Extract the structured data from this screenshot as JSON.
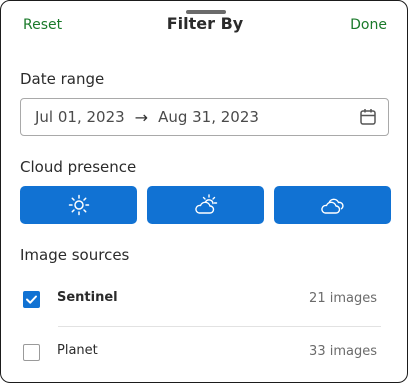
{
  "header": {
    "reset_label": "Reset",
    "title": "Filter By",
    "done_label": "Done"
  },
  "date_range": {
    "label": "Date range",
    "start": "Jul 01, 2023",
    "arrow": "→",
    "end": "Aug 31, 2023",
    "icon": "calendar-icon"
  },
  "cloud_presence": {
    "label": "Cloud presence",
    "options": [
      {
        "icon": "sun-icon",
        "selected": true
      },
      {
        "icon": "partly-cloudy-icon",
        "selected": true
      },
      {
        "icon": "cloudy-icon",
        "selected": true
      }
    ]
  },
  "image_sources": {
    "label": "Image sources",
    "items": [
      {
        "name": "Sentinel",
        "count": "21 images",
        "checked": true
      },
      {
        "name": "Planet",
        "count": "33 images",
        "checked": false
      }
    ]
  },
  "colors": {
    "accent": "#1172d3",
    "link": "#1a7a2a"
  }
}
